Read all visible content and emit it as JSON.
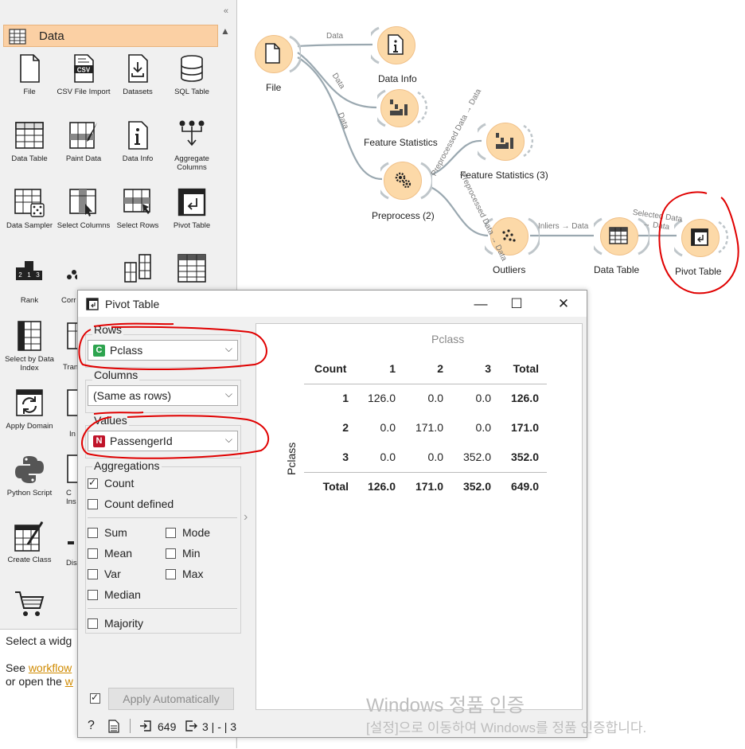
{
  "toolbox": {
    "category_title": "Data",
    "widgets": [
      {
        "label": "File",
        "icon": "file-icon"
      },
      {
        "label": "CSV File Import",
        "icon": "csv-file-icon"
      },
      {
        "label": "Datasets",
        "icon": "datasets-icon"
      },
      {
        "label": "SQL Table",
        "icon": "database-icon"
      },
      {
        "label": "Data Table",
        "icon": "table-icon"
      },
      {
        "label": "Paint Data",
        "icon": "paint-data-icon"
      },
      {
        "label": "Data Info",
        "icon": "info-icon"
      },
      {
        "label": "Aggregate Columns",
        "icon": "aggregate-icon"
      },
      {
        "label": "Data Sampler",
        "icon": "dice-table-icon"
      },
      {
        "label": "Select Columns",
        "icon": "select-columns-icon"
      },
      {
        "label": "Select Rows",
        "icon": "select-rows-icon"
      },
      {
        "label": "Pivot Table",
        "icon": "pivot-icon"
      },
      {
        "label": "Rank",
        "icon": "rank-icon"
      },
      {
        "label": "Corr",
        "icon": "correlations-icon"
      },
      {
        "label": "",
        "icon": "merge-icon"
      },
      {
        "label": "",
        "icon": "grid-table-icon"
      },
      {
        "label": "Select by Data Index",
        "icon": "select-index-icon"
      },
      {
        "label": "Tran",
        "icon": "transpose-icon"
      },
      {
        "label": "Apply Domain",
        "icon": "apply-domain-icon"
      },
      {
        "label": "In",
        "icon": "impute-icon"
      },
      {
        "label": "Python Script",
        "icon": "python-icon"
      },
      {
        "label": "C Ins",
        "icon": "create-instance-icon"
      },
      {
        "label": "Create Class",
        "icon": "create-class-icon"
      },
      {
        "label": "Dis",
        "icon": "discretize-icon"
      },
      {
        "label": "",
        "icon": "cart-icon"
      }
    ],
    "help": {
      "line1": "Select a widg",
      "line2_prefix": "See ",
      "line2_link": "workflow",
      "line3_prefix": "or open the ",
      "line3_link": "w"
    }
  },
  "canvas": {
    "nodes": [
      {
        "label": "File",
        "icon": "file-icon"
      },
      {
        "label": "Data Info",
        "icon": "info-icon"
      },
      {
        "label": "Feature Statistics",
        "icon": "bar-chart-icon"
      },
      {
        "label": "Preprocess (2)",
        "icon": "gears-icon"
      },
      {
        "label": "Feature Statistics (3)",
        "icon": "bar-chart-icon"
      },
      {
        "label": "Outliers",
        "icon": "scatter-icon"
      },
      {
        "label": "Data Table",
        "icon": "table-icon"
      },
      {
        "label": "Pivot Table",
        "icon": "pivot-icon"
      }
    ],
    "edges": [
      {
        "label": "Data"
      },
      {
        "label": "Data"
      },
      {
        "label": "Data"
      },
      {
        "label": "Preprocessed Data → Data"
      },
      {
        "label": "Preprocessed Data → Data"
      },
      {
        "label": "Inliers → Data"
      },
      {
        "label": "Selected Data → Data"
      }
    ]
  },
  "dialog": {
    "title": "Pivot Table",
    "rows": {
      "title": "Rows",
      "tag": "C",
      "value": "Pclass",
      "tag_color": "#2ea44f"
    },
    "columns": {
      "title": "Columns",
      "value": "(Same as rows)"
    },
    "values": {
      "title": "Values",
      "tag": "N",
      "value": "PassengerId",
      "tag_color": "#c0142a"
    },
    "aggregations": {
      "title": "Aggregations",
      "items": [
        {
          "label": "Count",
          "checked": true
        },
        {
          "label": "Count defined",
          "checked": false
        },
        {
          "label": "Sum",
          "checked": false
        },
        {
          "label": "Mode",
          "checked": false
        },
        {
          "label": "Mean",
          "checked": false
        },
        {
          "label": "Min",
          "checked": false
        },
        {
          "label": "Var",
          "checked": false
        },
        {
          "label": "Max",
          "checked": false
        },
        {
          "label": "Median",
          "checked": false
        },
        {
          "label": "Majority",
          "checked": false
        }
      ]
    },
    "table": {
      "col_var": "Pclass",
      "row_var": "Pclass",
      "corner": "Count",
      "headers": [
        "1",
        "2",
        "3",
        "Total"
      ],
      "rows": [
        {
          "label": "1",
          "cells": [
            "126.0",
            "0.0",
            "0.0",
            "126.0"
          ]
        },
        {
          "label": "2",
          "cells": [
            "0.0",
            "171.0",
            "0.0",
            "171.0"
          ]
        },
        {
          "label": "3",
          "cells": [
            "0.0",
            "0.0",
            "352.0",
            "352.0"
          ]
        },
        {
          "label": "Total",
          "cells": [
            "126.0",
            "171.0",
            "352.0",
            "649.0"
          ]
        }
      ]
    },
    "apply": {
      "label": "Apply Automatically",
      "checked": true
    },
    "status": {
      "input_count": "649",
      "output_summary": "3 | - | 3"
    }
  },
  "watermark": {
    "line1": "Windows 정품 인증",
    "line2": "[설정]으로 이동하여 Windows를 정품 인증합니다."
  },
  "colors": {
    "node_fill": "#fcd9a8",
    "category_header": "#fbd0a4",
    "annotation": "#e00000",
    "link": "#d08a00"
  }
}
